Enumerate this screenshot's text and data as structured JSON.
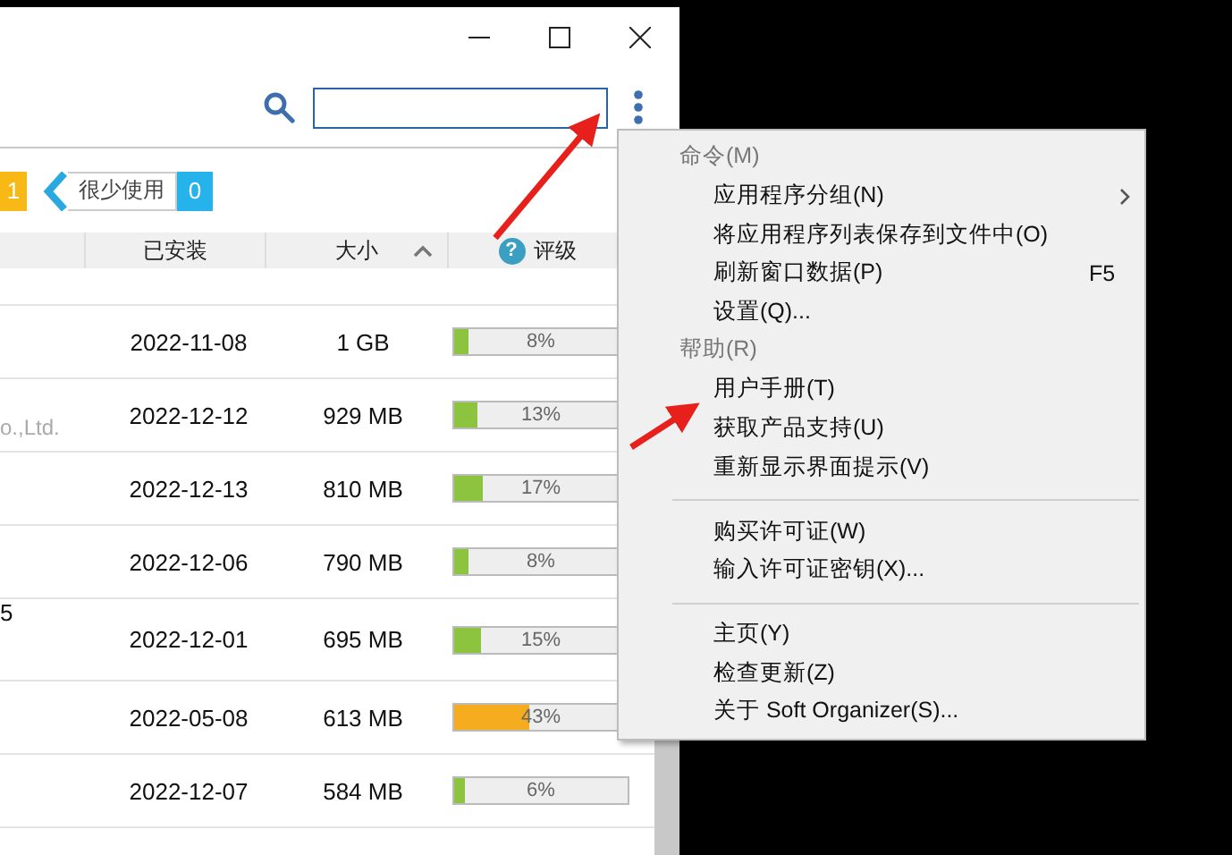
{
  "filter": {
    "previous_count": "1",
    "label": "很少使用",
    "count": "0"
  },
  "columns": [
    {
      "label": "已安装",
      "sorted": false
    },
    {
      "label": "大小",
      "sorted": true
    },
    {
      "label": "评级",
      "sorted": false,
      "help": "?"
    }
  ],
  "rows": [
    {
      "publisher_fragment": "",
      "installed": "2022-11-08",
      "size": "1 GB",
      "rating": "8%",
      "level": 0.08
    },
    {
      "publisher_fragment": "o.,Ltd.",
      "installed": "2022-12-12",
      "size": "929 MB",
      "rating": "13%",
      "level": 0.13
    },
    {
      "publisher_fragment": "",
      "installed": "2022-12-13",
      "size": "810 MB",
      "rating": "17%",
      "level": 0.17
    },
    {
      "publisher_fragment": "",
      "installed": "2022-12-06",
      "size": "790 MB",
      "rating": "8%",
      "level": 0.08
    },
    {
      "publisher_fragment": "5",
      "installed": "2022-12-01",
      "size": "695 MB",
      "rating": "15%",
      "level": 0.15
    },
    {
      "publisher_fragment": "",
      "installed": "2022-05-08",
      "size": "613 MB",
      "rating": "43%",
      "level": 0.43
    },
    {
      "publisher_fragment": "",
      "installed": "2022-12-07",
      "size": "584 MB",
      "rating": "6%",
      "level": 0.06
    }
  ],
  "menu": {
    "groups": [
      {
        "header": "命令(M)",
        "items": [
          {
            "label": "应用程序分组(N)",
            "submenu": true
          },
          {
            "label": "将应用程序列表保存到文件中(O)",
            "submenu": false
          },
          {
            "label": "刷新窗口数据(P)",
            "submenu": false,
            "shortcut": "F5"
          },
          {
            "label": "设置(Q)...",
            "submenu": false
          }
        ]
      },
      {
        "header": "帮助(R)",
        "items": [
          {
            "label": "用户手册(T)",
            "submenu": false
          },
          {
            "label": "获取产品支持(U)",
            "submenu": false
          },
          {
            "label": "重新显示界面提示(V)",
            "submenu": false
          }
        ]
      },
      {
        "items": [
          {
            "label": "购买许可证(W)",
            "submenu": false
          },
          {
            "label": "输入许可证密钥(X)...",
            "submenu": false
          }
        ]
      },
      {
        "items": [
          {
            "label": "主页(Y)",
            "submenu": false
          },
          {
            "label": "检查更新(Z)",
            "submenu": false
          },
          {
            "label": "关于 Soft Organizer(S)...",
            "submenu": false
          }
        ]
      }
    ]
  }
}
